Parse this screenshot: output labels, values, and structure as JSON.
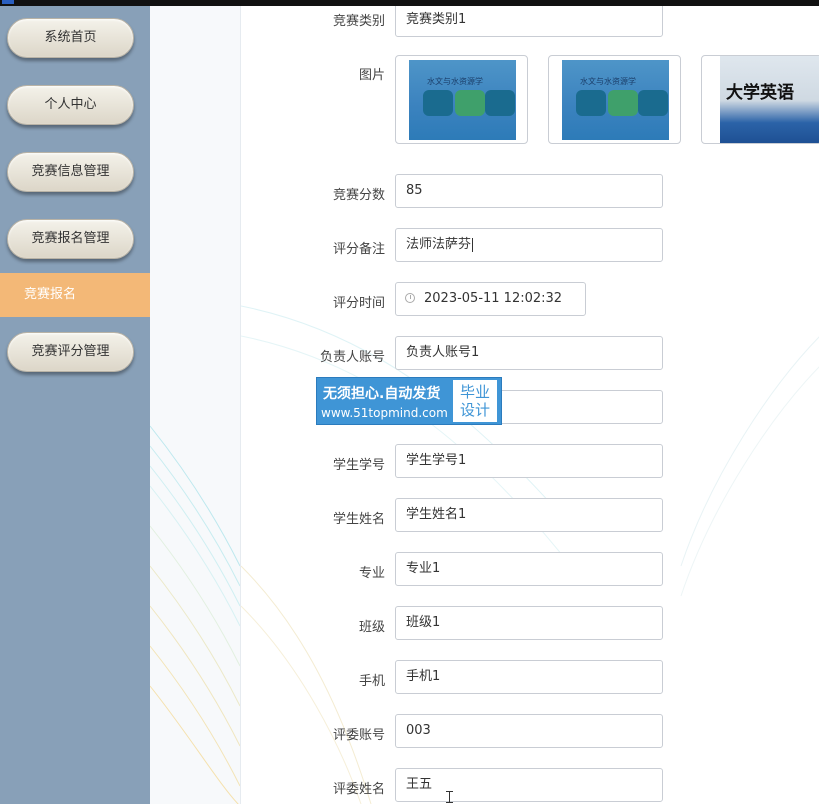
{
  "sidebar": {
    "items": [
      {
        "label": "系统首页"
      },
      {
        "label": "个人中心"
      },
      {
        "label": "竞赛信息管理"
      },
      {
        "label": "竞赛报名管理"
      },
      {
        "label": "竞赛报名",
        "active": true
      },
      {
        "label": "竞赛评分管理"
      }
    ]
  },
  "form": {
    "category_label": "竞赛类别",
    "category_value": "竞赛类别1",
    "image_label": "图片",
    "images": [
      {
        "title": "水文与水资源学",
        "kind": "book-cover"
      },
      {
        "title": "水文与水资源学",
        "kind": "book-cover"
      },
      {
        "title": "大学英语",
        "kind": "book-cover"
      }
    ],
    "score_label": "竞赛分数",
    "score_value": "85",
    "note_label": "评分备注",
    "note_value": "法师法萨芬",
    "time_label": "评分时间",
    "time_value": "2023-05-11 12:02:32",
    "leader_account_label": "负责人账号",
    "leader_account_value": "负责人账号1",
    "student_id_label": "学生学号",
    "student_id_value": "学生学号1",
    "student_name_label": "学生姓名",
    "student_name_value": "学生姓名1",
    "major_label": "专业",
    "major_value": "专业1",
    "class_label": "班级",
    "class_value": "班级1",
    "phone_label": "手机",
    "phone_value": "手机1",
    "judge_account_label": "评委账号",
    "judge_account_value": "003",
    "judge_name_label": "评委姓名",
    "judge_name_value": "王五"
  },
  "watermark": {
    "line1": "无须担心.自动发货",
    "line2": "www.51topmind.com",
    "badge_line1": "毕业",
    "badge_line2": "设计"
  },
  "colors": {
    "sidebar_bg": "#88a0b8",
    "active_item": "#f3b877",
    "watermark_blue": "#3f95d6"
  }
}
